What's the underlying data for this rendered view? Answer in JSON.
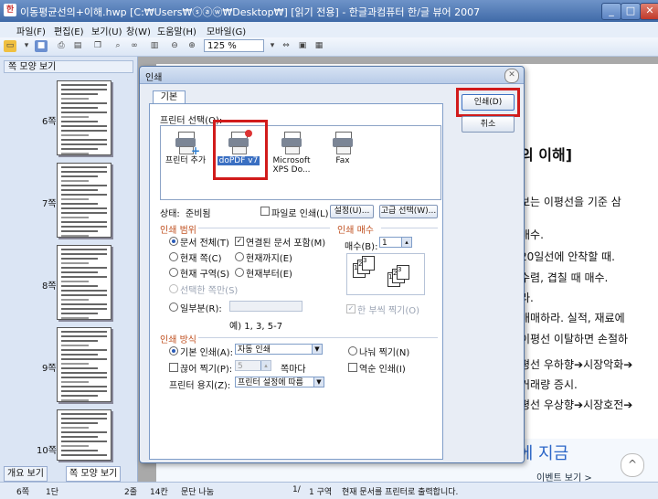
{
  "window": {
    "title": "이동평균선의+이해.hwp [C:₩Users₩ⓢⓐⓦ₩Desktop₩] [읽기 전용] - 한글과컴퓨터 한/글 뷰어 2007",
    "icon": "hwp-app-icon",
    "minimize": "_",
    "maximize": "□",
    "close": "✕"
  },
  "menu": [
    "파일(F)",
    "편집(E)",
    "보기(U)",
    "창(W)",
    "도움말(H)",
    "모바일(G)"
  ],
  "toolbar": {
    "zoom": "125 %"
  },
  "left_panel": {
    "title": "쪽 모양 보기",
    "pages": [
      "6쪽",
      "7쪽",
      "8쪽",
      "9쪽",
      "10쪽"
    ],
    "tabs": [
      "개요 보기",
      "쪽 모양 보기"
    ]
  },
  "document": {
    "lines": [
      "의 이해]",
      "보는 이평선을 기준 삼",
      "매수.",
      "20일선에 안착할 때.",
      "수렴, 겹칠 때 매수.",
      "라.",
      "매매하라. 실적, 재료에",
      "이평선 이탈하면 손절하",
      "평선 우하향➔시장악화➔",
      "거래량 증시.",
      "평선 우상향➔시장호전➔"
    ],
    "banner": "말랑말랑한 오픈 기념 EVENT에 지금",
    "event_link": "이벤트 보기 >",
    "up_button": "^"
  },
  "status": [
    "6쪽",
    "1단",
    "2줄",
    "14칸",
    "문단 나눔",
    "1/",
    "1 구역",
    "현재 문서를 프린터로 출력합니다."
  ],
  "dialog": {
    "title": "인쇄",
    "close": "✕",
    "tab": "기본",
    "printer_select_label": "프린터 선택(O):",
    "printers": [
      {
        "name": "프린터 추가",
        "icon": "printer-add-icon"
      },
      {
        "name": "doPDF v7",
        "icon": "printer-icon"
      },
      {
        "name": "Microsoft XPS Do...",
        "icon": "printer-icon"
      },
      {
        "name": "Fax",
        "icon": "fax-icon"
      }
    ],
    "selected_printer": "doPDF v7",
    "status_label": "상태:",
    "status_value": "준비됨",
    "print_to_file": "파일로 인쇄(L)",
    "settings_button": "설정(U)...",
    "advanced_button": "고급 선택(W)...",
    "print_button": "인쇄(D)",
    "cancel_button": "취소",
    "range": {
      "title": "인쇄 범위",
      "options": [
        "문서 전체(T)",
        "현재 쪽(C)",
        "현재 구역(S)",
        "선택한 쪽만(S)",
        "일부분(R):"
      ],
      "checks": [
        "연결된 문서 포함(M)"
      ],
      "options2": [
        "현재까지(E)",
        "현재부터(E)"
      ],
      "example": "예) 1, 3, 5-7"
    },
    "copies": {
      "title": "인쇄 매수",
      "label": "매수(B):",
      "value": "1",
      "collate": "한 부씩 찍기(O)"
    },
    "method": {
      "title": "인쇄 방식",
      "basic_label": "기본 인쇄(A):",
      "basic_value": "자동 인쇄",
      "split_label": "나눠 찍기(N)",
      "skip_label": "끊어 찍기(P):",
      "skip_value": "5",
      "skip_unit": "쪽마다",
      "reverse_label": "역순 인쇄(I)",
      "paper_label": "프린터 용지(Z):",
      "paper_value": "프린터 설정에 따름"
    }
  },
  "colors": {
    "highlight": "#d11b1b",
    "accent": "#2b66c8"
  }
}
